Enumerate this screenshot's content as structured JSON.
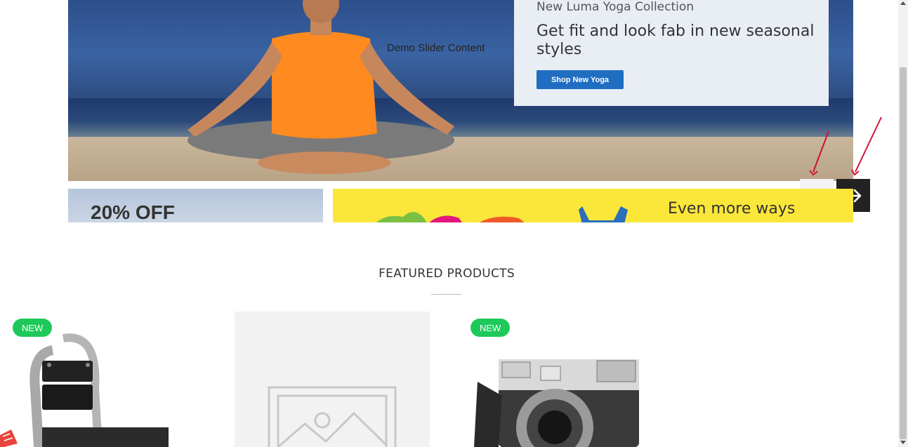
{
  "hero": {
    "demo_text": "Demo Slider Content",
    "promo_subtitle": "New Luma Yoga Collection",
    "promo_title": "Get fit and look fab in new seasonal styles",
    "promo_button": "Shop New Yoga"
  },
  "banners": {
    "left_text": "20% OFF",
    "right_text": "Even more ways"
  },
  "featured": {
    "title": "FEATURED PRODUCTS",
    "products": [
      {
        "badge": "NEW",
        "image": "exercise-machine"
      },
      {
        "badge": "",
        "image": "placeholder-image"
      },
      {
        "badge": "NEW",
        "image": "vintage-camera"
      }
    ]
  },
  "colors": {
    "badge": "#1ec95b",
    "promo_button": "#1f6ec2",
    "arrow_next_bg": "#222222",
    "annotation": "#d0103a"
  }
}
